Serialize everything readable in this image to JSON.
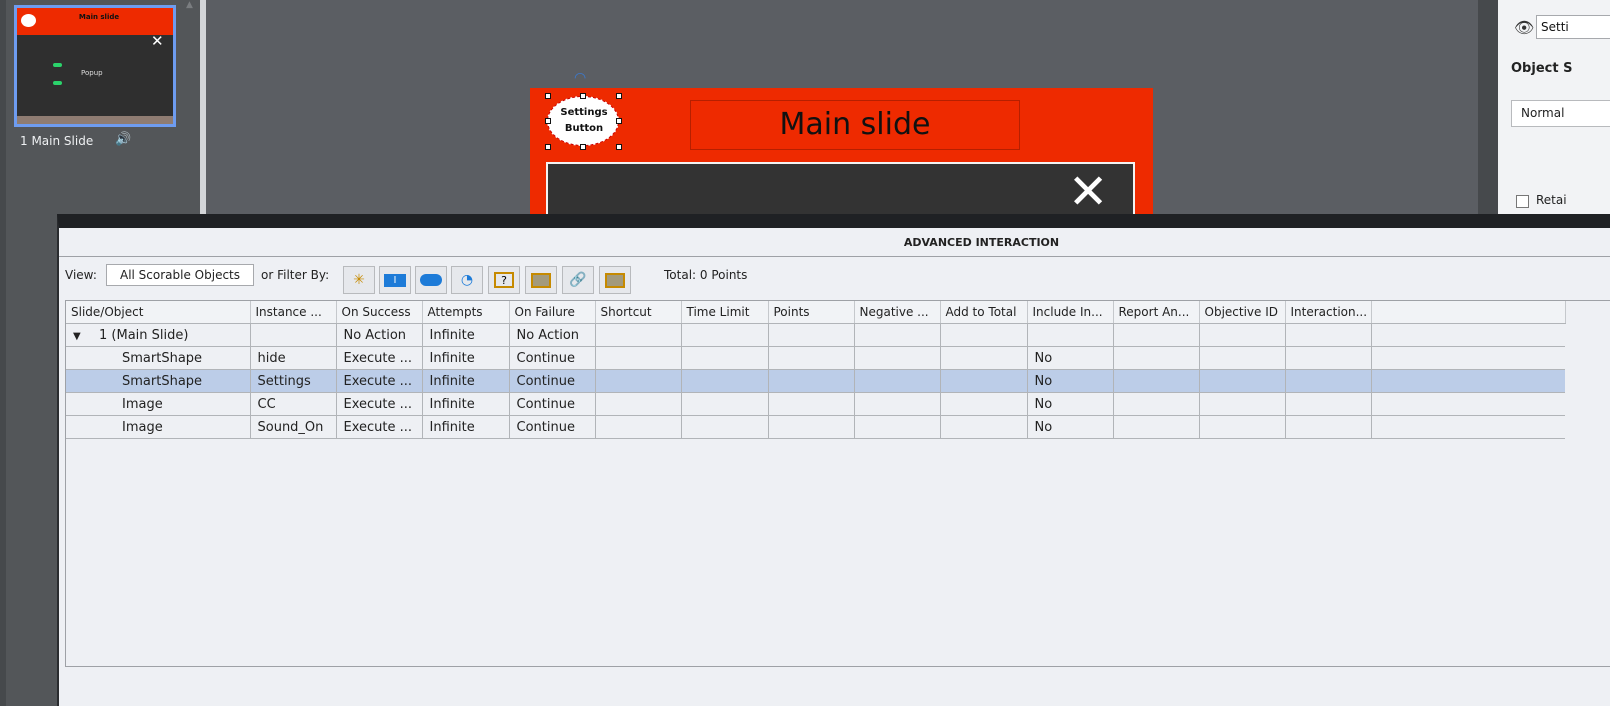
{
  "filmstrip": {
    "slide_label": "1 Main Slide",
    "thumb_title": "Main slide",
    "thumb_popup": "Popup",
    "speaker_icon": "speaker-icon"
  },
  "stage": {
    "slide_title": "Main slide",
    "settings_button_label": "Settings Button",
    "close_icon": "close-icon",
    "accent_color": "#ee2a00"
  },
  "properties": {
    "name_value": "Setti",
    "heading": "Object S",
    "state_value": "Normal",
    "retain_label": "Retai"
  },
  "dialog": {
    "title": "ADVANCED INTERACTION",
    "view_label": "View:",
    "view_value": "All Scorable Objects",
    "filter_label": "or Filter By:",
    "total": "Total: 0 Points",
    "filter_icons": [
      "click-box-icon",
      "text-entry-icon",
      "button-icon",
      "widget-icon",
      "question-icon",
      "image-icon",
      "link-icon",
      "image-button-icon"
    ],
    "columns": [
      "Slide/Object",
      "Instance ...",
      "On Success",
      "Attempts",
      "On Failure",
      "Shortcut",
      "Time Limit",
      "Points",
      "Negative ...",
      "Add to Total",
      "Include In...",
      "Report An...",
      "Objective ID",
      "Interaction..."
    ],
    "rows": [
      {
        "object": "1 (Main Slide)",
        "instance": "",
        "on_success": "No Action",
        "attempts": "Infinite",
        "on_failure": "No Action",
        "include": "",
        "group": true,
        "selected": false
      },
      {
        "object": "SmartShape",
        "instance": "hide",
        "on_success": "Execute ...",
        "attempts": "Infinite",
        "on_failure": "Continue",
        "include": "No",
        "group": false,
        "selected": false
      },
      {
        "object": "SmartShape",
        "instance": "Settings",
        "on_success": "Execute ...",
        "attempts": "Infinite",
        "on_failure": "Continue",
        "include": "No",
        "group": false,
        "selected": true
      },
      {
        "object": "Image",
        "instance": "CC",
        "on_success": "Execute ...",
        "attempts": "Infinite",
        "on_failure": "Continue",
        "include": "No",
        "group": false,
        "selected": false
      },
      {
        "object": "Image",
        "instance": "Sound_On",
        "on_success": "Execute ...",
        "attempts": "Infinite",
        "on_failure": "Continue",
        "include": "No",
        "group": false,
        "selected": false
      }
    ]
  }
}
